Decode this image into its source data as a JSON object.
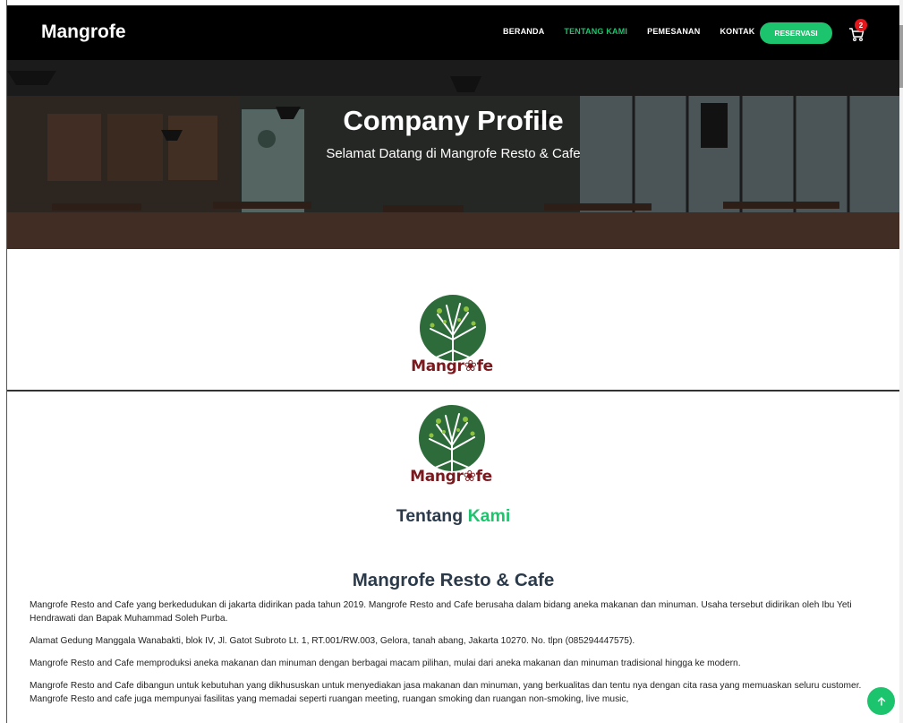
{
  "navbar": {
    "brand": "Mangrofe",
    "links": [
      {
        "label": "BERANDA",
        "active": false
      },
      {
        "label": "TENTANG KAMI",
        "active": true
      },
      {
        "label": "PEMESANAN",
        "active": false
      },
      {
        "label": "KONTAK",
        "active": false
      }
    ],
    "reservasi_label": "RESERVASI",
    "cart_icon": "cart-icon",
    "cart_count": "2"
  },
  "hero": {
    "title": "Company Profile",
    "subtitle": "Selamat Datang di Mangrofe Resto & Cafe"
  },
  "logo": {
    "wordmark": "Mangr❀fe",
    "icon": "mangrove-tree-logo"
  },
  "about": {
    "heading_prefix": "Tentang",
    "heading_accent": "Kami",
    "title": "Mangrofe Resto & Cafe",
    "paragraphs": [
      "Mangrofe Resto and Cafe yang berkedudukan di jakarta didirikan pada tahun 2019. Mangrofe Resto and Cafe berusaha dalam bidang aneka makanan dan minuman. Usaha tersebut didirikan oleh Ibu Yeti Hendrawati dan Bapak Muhammad Soleh Purba.",
      "Alamat Gedung Manggala Wanabakti, blok IV, Jl. Gatot Subroto Lt. 1, RT.001/RW.003, Gelora, tanah abang, Jakarta 10270. No. tlpn (085294447575).",
      "Mangrofe Resto and Cafe memproduksi aneka makanan dan minuman dengan berbagai macam pilihan, mulai dari aneka makanan dan minuman tradisional hingga ke modern.",
      "Mangrofe Resto and Cafe dibangun untuk kebutuhan yang dikhususkan untuk menyediakan jasa makanan dan minuman, yang berkualitas dan tentu nya dengan cita rasa yang memuaskan seluru customer. Mangrofe Resto and cafe juga mempunyai fasilitas yang memadai seperti ruangan meeting, ruangan smoking dan ruangan non-smoking, live music,"
    ]
  },
  "colors": {
    "accent": "#1cc46d",
    "navbar": "#000000",
    "badge": "#e3161b",
    "logo_green": "#2d6b3a",
    "logo_wordmark": "#7a1a1f"
  },
  "scroll_top_icon": "arrow-up-icon"
}
